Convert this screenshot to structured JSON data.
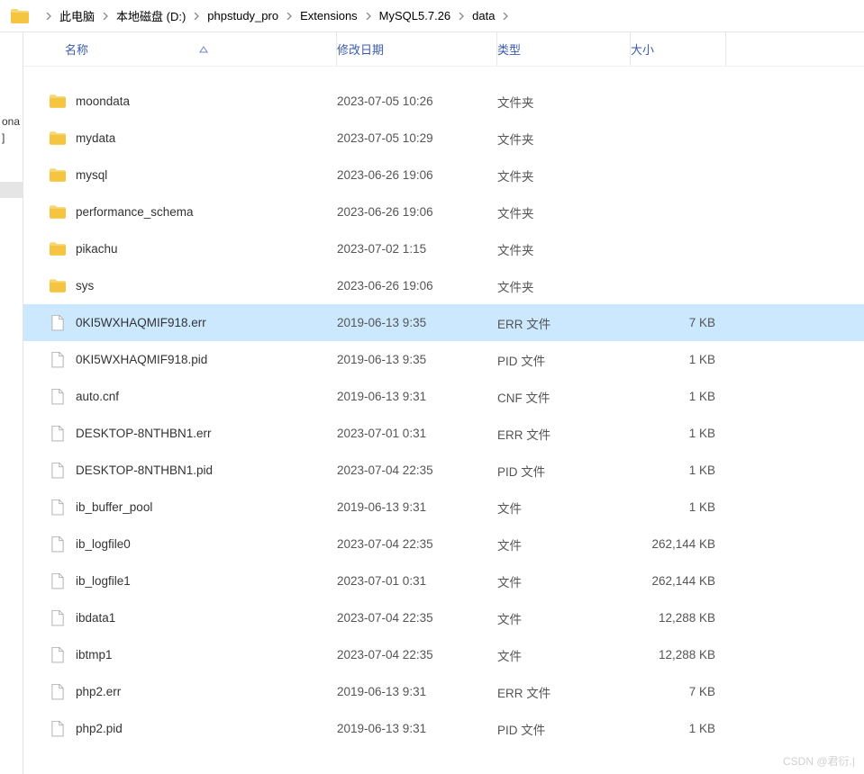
{
  "breadcrumb": [
    "此电脑",
    "本地磁盘 (D:)",
    "phpstudy_pro",
    "Extensions",
    "MySQL5.7.26",
    "data"
  ],
  "columns": {
    "name": "名称",
    "date": "修改日期",
    "type": "类型",
    "size": "大小"
  },
  "left_panel": {
    "line1": "ona",
    "line2": "]"
  },
  "files": [
    {
      "icon": "folder",
      "name": "moondata",
      "date": "2023-07-05 10:26",
      "type": "文件夹",
      "size": "",
      "selected": false
    },
    {
      "icon": "folder",
      "name": "mydata",
      "date": "2023-07-05 10:29",
      "type": "文件夹",
      "size": "",
      "selected": false
    },
    {
      "icon": "folder",
      "name": "mysql",
      "date": "2023-06-26 19:06",
      "type": "文件夹",
      "size": "",
      "selected": false
    },
    {
      "icon": "folder",
      "name": "performance_schema",
      "date": "2023-06-26 19:06",
      "type": "文件夹",
      "size": "",
      "selected": false
    },
    {
      "icon": "folder",
      "name": "pikachu",
      "date": "2023-07-02 1:15",
      "type": "文件夹",
      "size": "",
      "selected": false
    },
    {
      "icon": "folder",
      "name": "sys",
      "date": "2023-06-26 19:06",
      "type": "文件夹",
      "size": "",
      "selected": false
    },
    {
      "icon": "file",
      "name": "0KI5WXHAQMIF918.err",
      "date": "2019-06-13 9:35",
      "type": "ERR 文件",
      "size": "7 KB",
      "selected": true
    },
    {
      "icon": "file",
      "name": "0KI5WXHAQMIF918.pid",
      "date": "2019-06-13 9:35",
      "type": "PID 文件",
      "size": "1 KB",
      "selected": false
    },
    {
      "icon": "file",
      "name": "auto.cnf",
      "date": "2019-06-13 9:31",
      "type": "CNF 文件",
      "size": "1 KB",
      "selected": false
    },
    {
      "icon": "file",
      "name": "DESKTOP-8NTHBN1.err",
      "date": "2023-07-01 0:31",
      "type": "ERR 文件",
      "size": "1 KB",
      "selected": false
    },
    {
      "icon": "file",
      "name": "DESKTOP-8NTHBN1.pid",
      "date": "2023-07-04 22:35",
      "type": "PID 文件",
      "size": "1 KB",
      "selected": false
    },
    {
      "icon": "file",
      "name": "ib_buffer_pool",
      "date": "2019-06-13 9:31",
      "type": "文件",
      "size": "1 KB",
      "selected": false
    },
    {
      "icon": "file",
      "name": "ib_logfile0",
      "date": "2023-07-04 22:35",
      "type": "文件",
      "size": "262,144 KB",
      "selected": false
    },
    {
      "icon": "file",
      "name": "ib_logfile1",
      "date": "2023-07-01 0:31",
      "type": "文件",
      "size": "262,144 KB",
      "selected": false
    },
    {
      "icon": "file",
      "name": "ibdata1",
      "date": "2023-07-04 22:35",
      "type": "文件",
      "size": "12,288 KB",
      "selected": false
    },
    {
      "icon": "file",
      "name": "ibtmp1",
      "date": "2023-07-04 22:35",
      "type": "文件",
      "size": "12,288 KB",
      "selected": false
    },
    {
      "icon": "file",
      "name": "php2.err",
      "date": "2019-06-13 9:31",
      "type": "ERR 文件",
      "size": "7 KB",
      "selected": false
    },
    {
      "icon": "file",
      "name": "php2.pid",
      "date": "2019-06-13 9:31",
      "type": "PID 文件",
      "size": "1 KB",
      "selected": false
    }
  ],
  "watermark": "CSDN @君衍.|"
}
